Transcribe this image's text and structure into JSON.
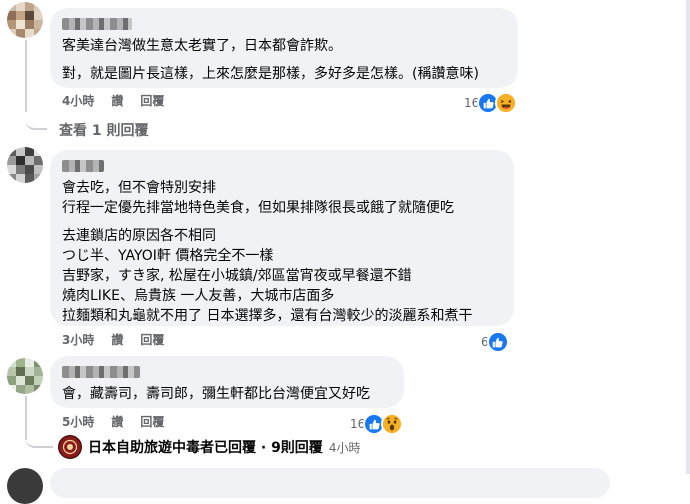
{
  "comments": [
    {
      "lines": [
        "客美達台灣做生意太老實了，日本都會詐欺。",
        "對，就是圖片長這樣，上來怎麼是那樣，多好多是怎樣。(稱讚意味)"
      ],
      "time": "4小時",
      "like": "讚",
      "reply": "回覆",
      "reactions": "16"
    },
    {
      "lines": [
        "會去吃，但不會特別安排",
        "行程一定優先排當地特色美食，但如果排隊很長或餓了就隨便吃",
        "",
        "去連鎖店的原因各不相同",
        "つじ半、YAYOI軒 價格完全不一樣",
        "吉野家，すき家, 松屋在小城鎮/郊區當宵夜或早餐還不錯",
        "燒肉LIKE、烏貴族 一人友善，大城市店面多",
        "拉麵類和丸龜就不用了 日本選擇多，還有台灣較少的淡麗系和煮干"
      ],
      "time": "3小時",
      "like": "讚",
      "reply": "回覆",
      "reactions": "6"
    },
    {
      "lines": [
        "會，藏壽司，壽司郎，彌生軒都比台灣便宜又好吃"
      ],
      "time": "5小時",
      "like": "讚",
      "reply": "回覆",
      "reactions": "16"
    }
  ],
  "view_replies": "查看 1 則回覆",
  "reply_summary": {
    "text": "日本自助旅遊中毒者已回覆 · 9則回覆",
    "time": "4小時"
  },
  "colors": {
    "like": "#1877f2",
    "meta": "#65676b",
    "bubble": "#f0f2f5"
  }
}
